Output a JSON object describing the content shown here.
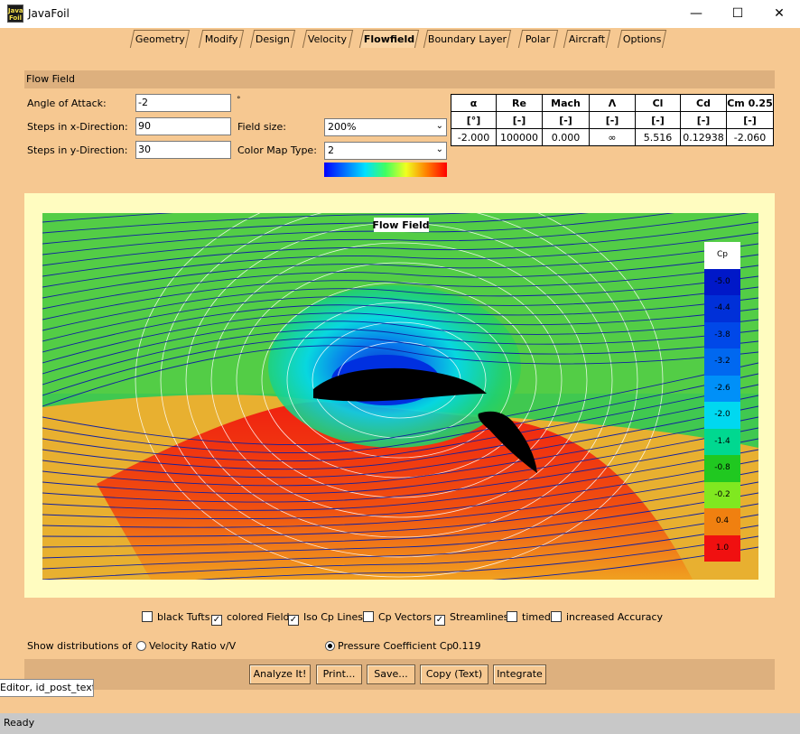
{
  "window": {
    "title": "JavaFoil",
    "icon_text": "Java Foil"
  },
  "tabs": [
    {
      "label": "Geometry"
    },
    {
      "label": "Modify"
    },
    {
      "label": "Design"
    },
    {
      "label": "Velocity"
    },
    {
      "label": "Flowfield"
    },
    {
      "label": "Boundary Layer"
    },
    {
      "label": "Polar"
    },
    {
      "label": "Aircraft"
    },
    {
      "label": "Options"
    }
  ],
  "active_tab": "Flowfield",
  "section_title": "Flow Field",
  "form": {
    "angle_label": "Angle of Attack:",
    "angle_value": "-2",
    "angle_unit": "°",
    "stepsx_label": "Steps in x-Direction:",
    "stepsx_value": "90",
    "stepsy_label": "Steps in y-Direction:",
    "stepsy_value": "30",
    "fieldsize_label": "Field size:",
    "fieldsize_value": "200%",
    "colormap_label": "Color Map Type:",
    "colormap_value": "2"
  },
  "results": {
    "headers": [
      "α",
      "Re",
      "Mach",
      "Λ",
      "Cl",
      "Cd",
      "Cm 0.25"
    ],
    "units": [
      "[°]",
      "[-]",
      "[-]",
      "[-]",
      "[-]",
      "[-]",
      "[-]"
    ],
    "values": [
      "-2.000",
      "100000",
      "0.000",
      "∞",
      "5.516",
      "0.12938",
      "-2.060"
    ]
  },
  "plot": {
    "title": "Flow Field",
    "legend_title": "Cp",
    "legend": [
      {
        "label": "-5.0",
        "color": "#0018c8"
      },
      {
        "label": "-4.4",
        "color": "#0030d8"
      },
      {
        "label": "-3.8",
        "color": "#0048e8"
      },
      {
        "label": "-3.2",
        "color": "#0068f0"
      },
      {
        "label": "-2.6",
        "color": "#0090f8"
      },
      {
        "label": "-2.0",
        "color": "#00d8f0"
      },
      {
        "label": "-1.4",
        "color": "#00d890"
      },
      {
        "label": "-0.8",
        "color": "#20c820"
      },
      {
        "label": "-0.2",
        "color": "#80e820"
      },
      {
        "label": "0.4",
        "color": "#f08010"
      },
      {
        "label": "1.0",
        "color": "#f01010"
      }
    ]
  },
  "options": {
    "black_tufts": {
      "label": "black Tufts",
      "checked": false
    },
    "colored_field": {
      "label": "colored Field",
      "checked": true
    },
    "iso_cp": {
      "label": "Iso Cp Lines",
      "checked": true
    },
    "cp_vectors": {
      "label": "Cp Vectors",
      "checked": false
    },
    "streamlines": {
      "label": "Streamlines",
      "checked": true
    },
    "timed": {
      "label": "timed",
      "checked": false
    },
    "increased_accuracy": {
      "label": "increased Accuracy",
      "checked": false
    }
  },
  "distributions": {
    "label": "Show distributions of",
    "velocity_ratio": "Velocity Ratio v/V",
    "pressure_coefficient": "Pressure Coefficient Cp",
    "value": "0.119",
    "selected": "pressure_coefficient"
  },
  "buttons": {
    "analyze": "Analyze It!",
    "print": "Print...",
    "save": "Save...",
    "copy": "Copy (Text)",
    "integrate": "Integrate"
  },
  "tooltip": "Editor, id_post_text",
  "status": "Ready"
}
